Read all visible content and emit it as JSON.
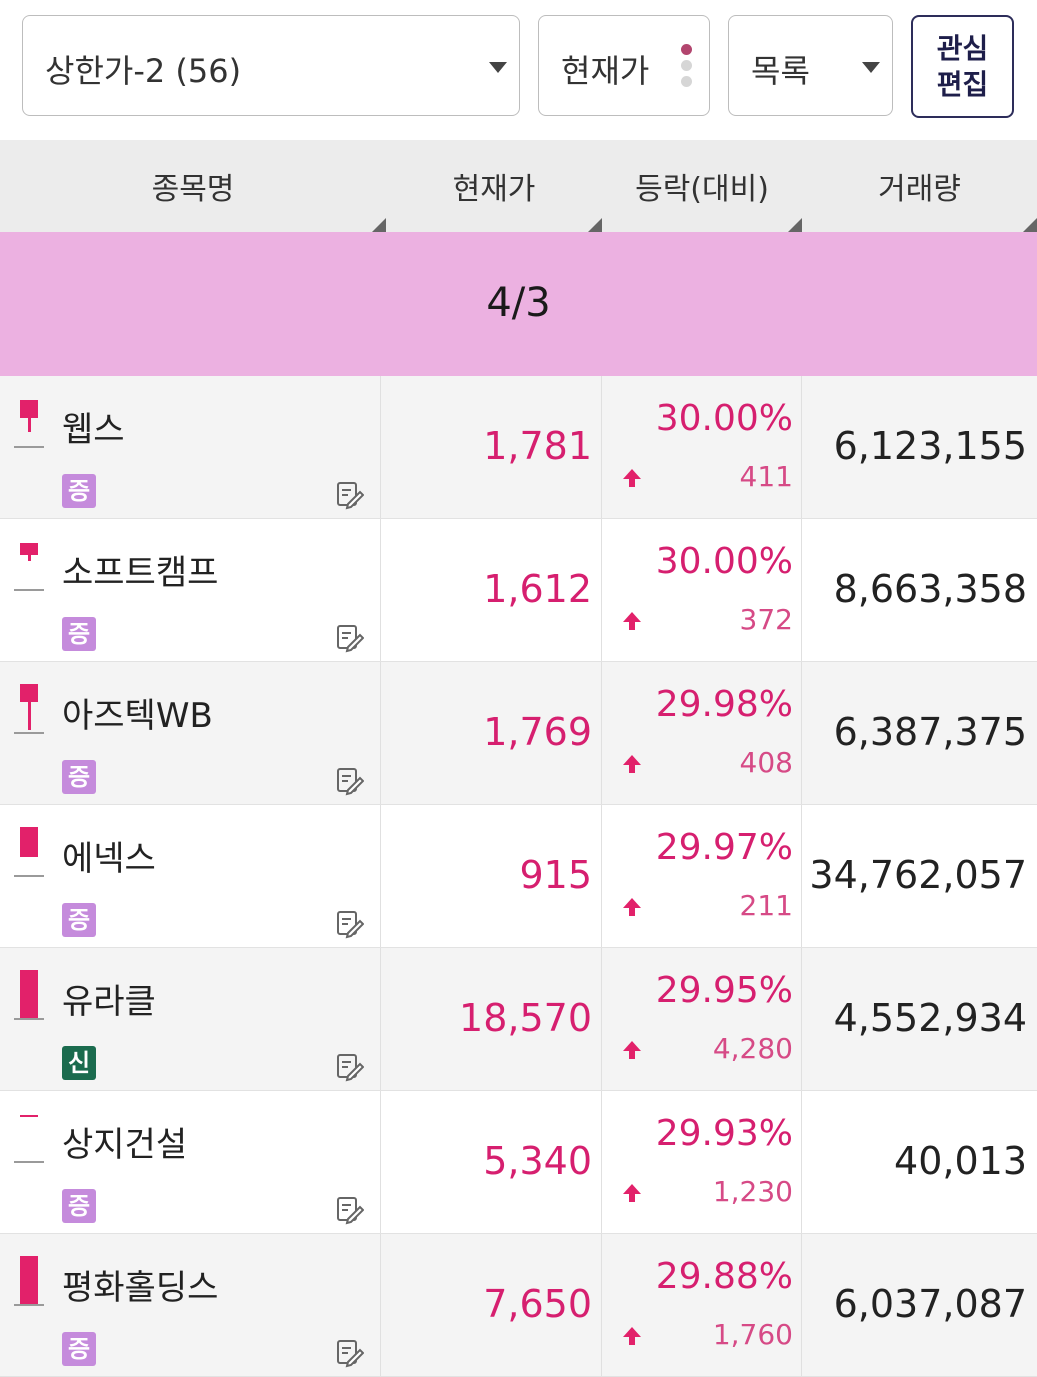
{
  "filter": {
    "selected": "상한가-2 (56)"
  },
  "price_filter": {
    "label": "현재가"
  },
  "view": {
    "label": "목록"
  },
  "edit_button": {
    "line1": "관심",
    "line2": "편집"
  },
  "columns": {
    "name": "종목명",
    "price": "현재가",
    "change": "등락(대비)",
    "volume": "거래량"
  },
  "date_label": "4/3",
  "rows": [
    {
      "name": "웹스",
      "badge": "증",
      "badge_type": "jeung",
      "price": "1,781",
      "rate": "30.00%",
      "diff": "411",
      "volume": "6,123,155"
    },
    {
      "name": "소프트캠프",
      "badge": "증",
      "badge_type": "jeung",
      "price": "1,612",
      "rate": "30.00%",
      "diff": "372",
      "volume": "8,663,358"
    },
    {
      "name": "아즈텍WB",
      "badge": "증",
      "badge_type": "jeung",
      "price": "1,769",
      "rate": "29.98%",
      "diff": "408",
      "volume": "6,387,375"
    },
    {
      "name": "에넥스",
      "badge": "증",
      "badge_type": "jeung",
      "price": "915",
      "rate": "29.97%",
      "diff": "211",
      "volume": "34,762,057"
    },
    {
      "name": "유라클",
      "badge": "신",
      "badge_type": "sin",
      "price": "18,570",
      "rate": "29.95%",
      "diff": "4,280",
      "volume": "4,552,934"
    },
    {
      "name": "상지건설",
      "badge": "증",
      "badge_type": "jeung",
      "price": "5,340",
      "rate": "29.93%",
      "diff": "1,230",
      "volume": "40,013"
    },
    {
      "name": "평화홀딩스",
      "badge": "증",
      "badge_type": "jeung",
      "price": "7,650",
      "rate": "29.88%",
      "diff": "1,760",
      "volume": "6,037,087"
    }
  ],
  "colors": {
    "up": "#d61f6f",
    "date_band": "#ecb1e1",
    "header_bg": "#ececec",
    "badge_jeung": "#c58bdc",
    "badge_sin": "#1b6b4e"
  }
}
